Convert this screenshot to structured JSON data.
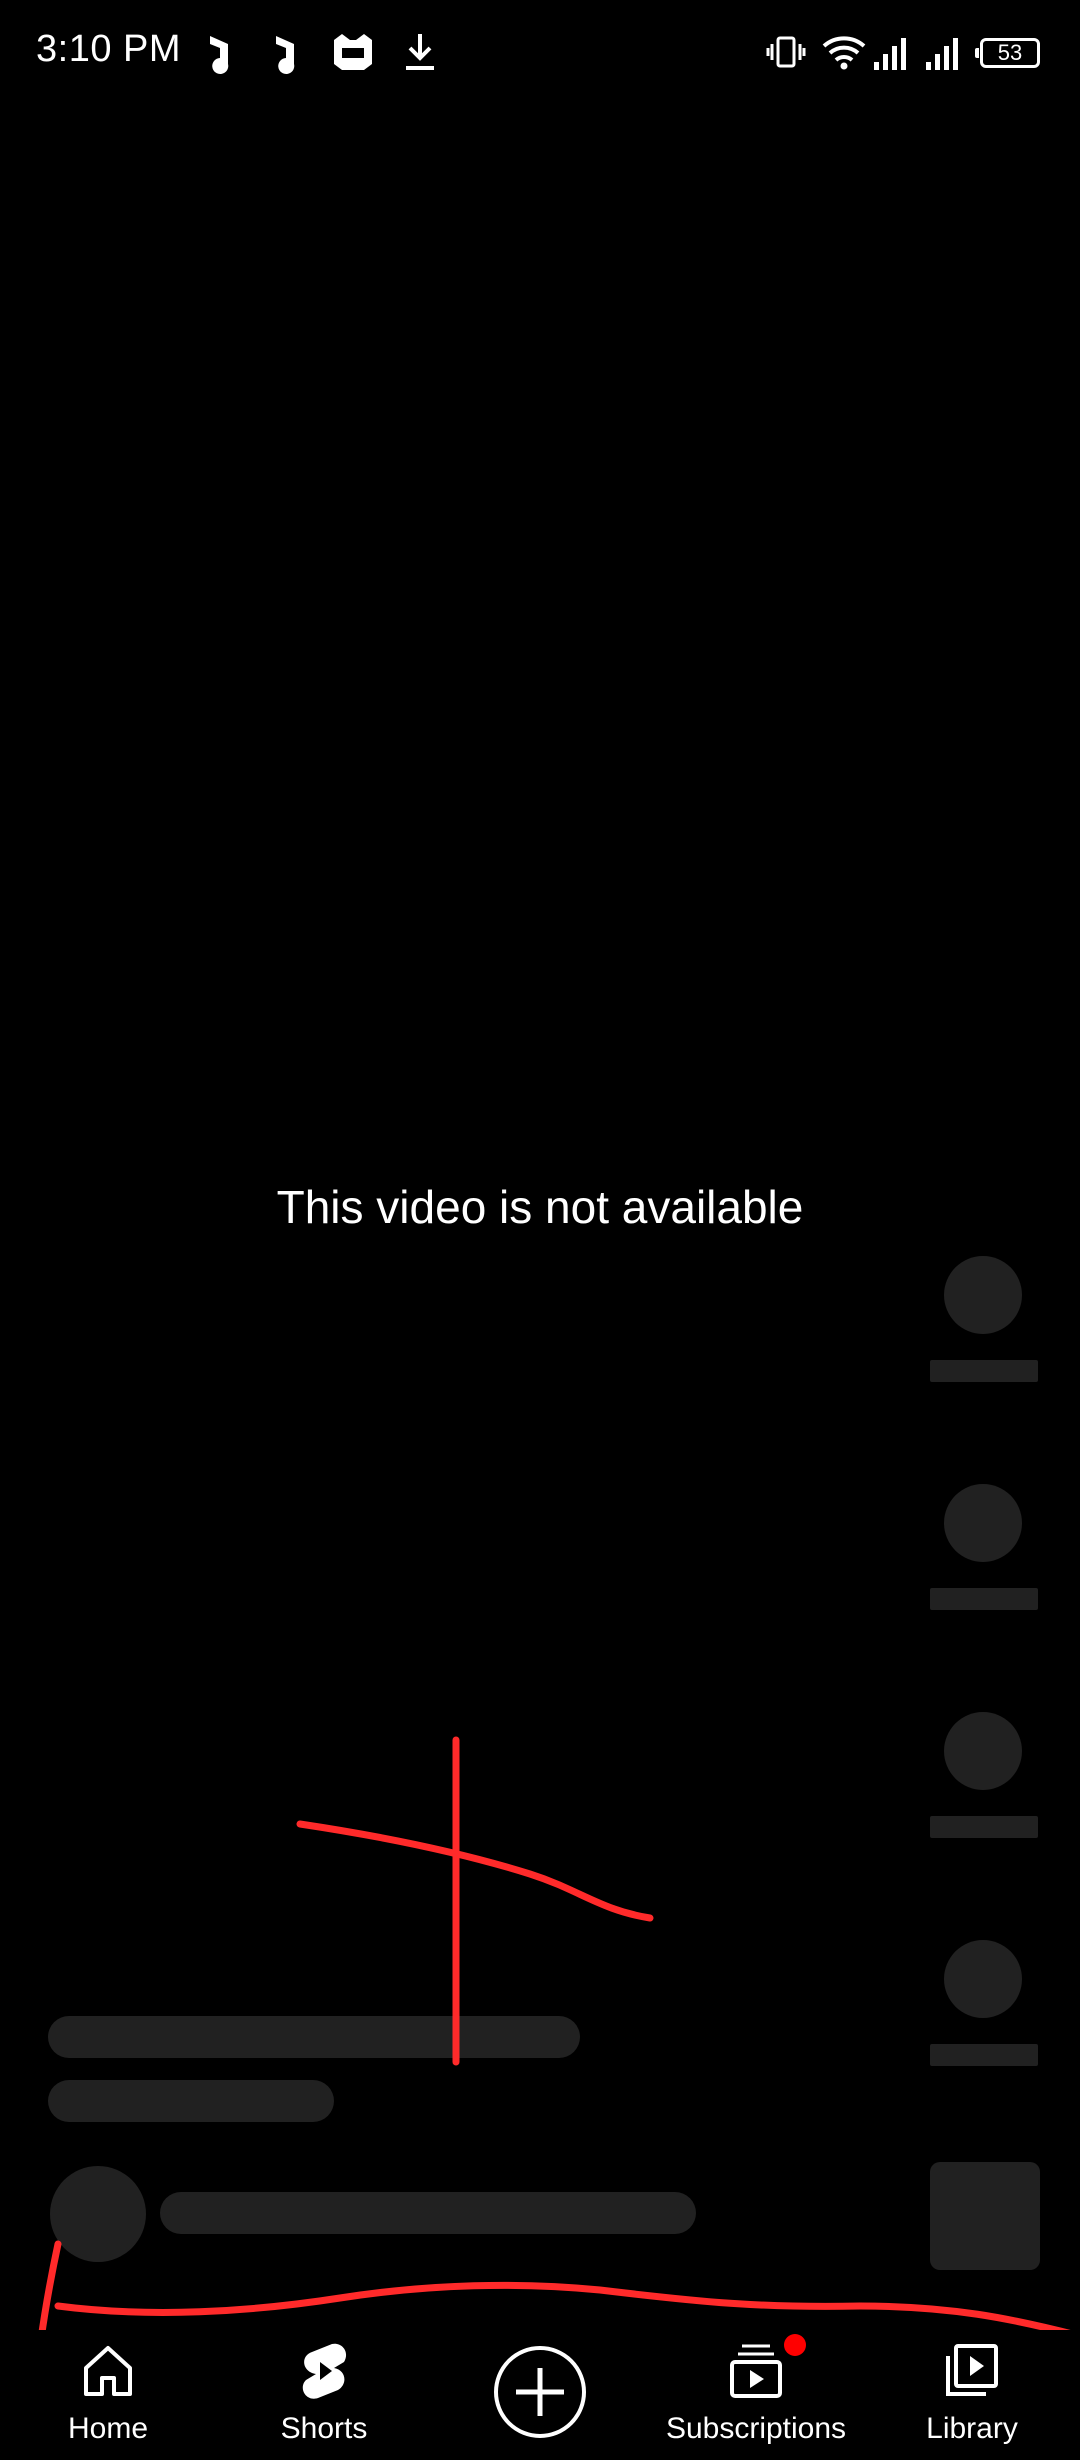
{
  "status_bar": {
    "time": "3:10 PM",
    "battery": "53",
    "left_icons": [
      "music-note-icon",
      "music-note-icon",
      "game-controller-icon",
      "download-icon"
    ],
    "right_icons": [
      "vibrate-icon",
      "wifi-icon",
      "signal-icon",
      "signal-icon",
      "battery-icon"
    ]
  },
  "player": {
    "message": "This video is not available"
  },
  "bottom_nav": {
    "items": [
      {
        "label": "Home",
        "icon": "home-icon"
      },
      {
        "label": "Shorts",
        "icon": "shorts-icon"
      },
      {
        "label": "",
        "icon": "create-plus-icon"
      },
      {
        "label": "Subscriptions",
        "icon": "subscriptions-icon",
        "badge": true
      },
      {
        "label": "Library",
        "icon": "library-icon"
      }
    ]
  },
  "colors": {
    "background": "#000000",
    "placeholder": "#212121",
    "annotation": "#ff2a2a",
    "badge": "#ff0000",
    "text": "#ffffff"
  }
}
